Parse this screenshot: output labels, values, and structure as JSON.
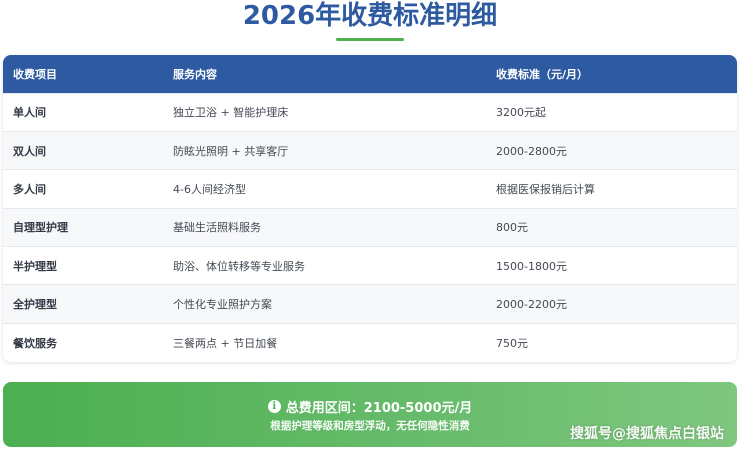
{
  "title": "2026年收费标准明细",
  "colors": {
    "header_blue": "#2d5aa0",
    "accent_green": "#4caf50"
  },
  "table": {
    "headers": [
      "收费项目",
      "服务内容",
      "收费标准（元/月）"
    ],
    "rows": [
      [
        "单人间",
        "独立卫浴 + 智能护理床",
        "3200元起"
      ],
      [
        "双人间",
        "防眩光照明 + 共享客厅",
        "2000-2800元"
      ],
      [
        "多人间",
        "4-6人间经济型",
        "根据医保报销后计算"
      ],
      [
        "自理型护理",
        "基础生活照料服务",
        "800元"
      ],
      [
        "半护理型",
        "助浴、体位转移等专业服务",
        "1500-1800元"
      ],
      [
        "全护理型",
        "个性化专业照护方案",
        "2000-2200元"
      ],
      [
        "餐饮服务",
        "三餐两点 + 节日加餐",
        "750元"
      ]
    ]
  },
  "summary": {
    "icon": "info-icon",
    "total": "总费用区间：2100-5000元/月",
    "note": "根据护理等级和房型浮动，无任何隐性消费"
  },
  "watermark": "搜狐号@搜狐焦点白银站"
}
